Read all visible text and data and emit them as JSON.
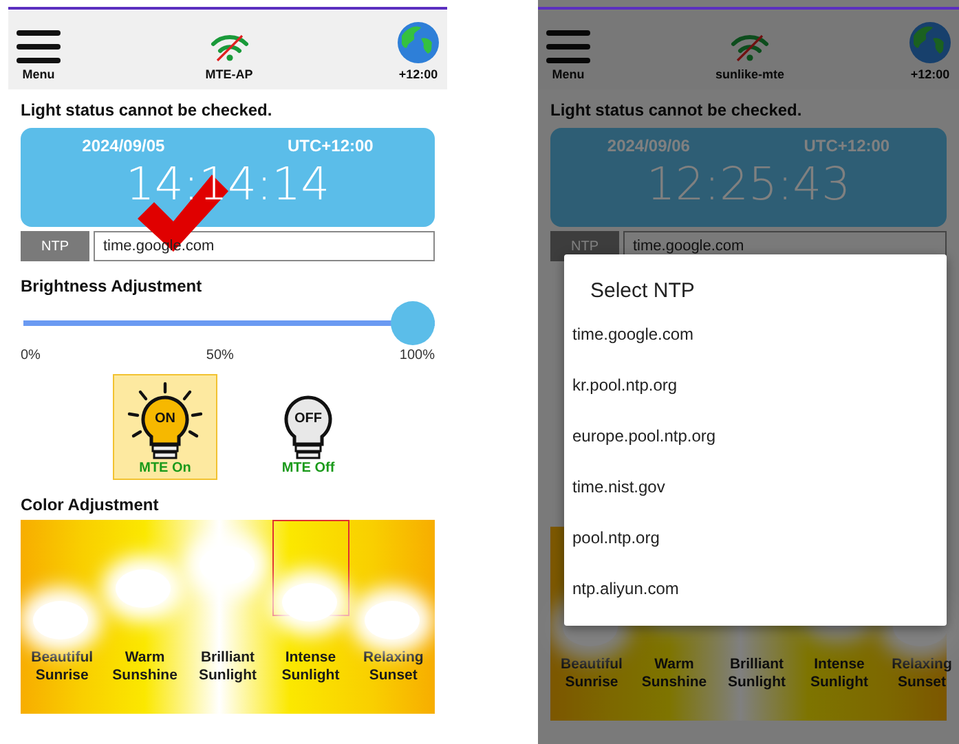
{
  "screens": [
    {
      "header": {
        "menu_label": "Menu",
        "network": "MTE-AP",
        "timezone": "+12:00"
      },
      "status": "Light status cannot be checked.",
      "clock": {
        "date": "2024/09/05",
        "utc": "UTC+12:00",
        "time": "14:14:14"
      },
      "ntp": {
        "label": "NTP",
        "value": "time.google.com"
      },
      "check_mark": true,
      "dimmed": false,
      "brightness": {
        "title": "Brightness Adjustment",
        "level": 1,
        "ticks": [
          "0%",
          "50%",
          "100%"
        ]
      },
      "modes": [
        {
          "kind": "on",
          "badge": "ON",
          "label": "MTE On",
          "selected": true
        },
        {
          "kind": "off",
          "badge": "OFF",
          "label": "MTE Off",
          "selected": false
        }
      ],
      "color": {
        "title": "Color Adjustment",
        "presets": [
          {
            "label": "Beautiful Sunrise",
            "selected": false
          },
          {
            "label": "Warm Sunshine",
            "selected": false
          },
          {
            "label": "Brilliant Sunlight",
            "selected": false
          },
          {
            "label": "Intense Sunlight",
            "selected": true
          },
          {
            "label": "Relaxing Sunset",
            "selected": false
          }
        ]
      }
    },
    {
      "header": {
        "menu_label": "Menu",
        "network": "sunlike-mte",
        "timezone": "+12:00"
      },
      "status": "Light status cannot be checked.",
      "clock": {
        "date": "2024/09/06",
        "utc": "UTC+12:00",
        "time": "12:25:43"
      },
      "ntp": {
        "label": "NTP",
        "value": "time.google.com"
      },
      "check_mark": false,
      "dimmed": true,
      "color": {
        "presets": [
          {
            "label": "Beautiful Sunrise",
            "selected": false
          },
          {
            "label": "Warm Sunshine",
            "selected": false
          },
          {
            "label": "Brilliant Sunlight",
            "selected": false
          },
          {
            "label": "Intense Sunlight",
            "selected": false
          },
          {
            "label": "Relaxing Sunset",
            "selected": false
          }
        ]
      },
      "dialog": {
        "title": "Select NTP",
        "options": [
          "time.google.com",
          "kr.pool.ntp.org",
          "europe.pool.ntp.org",
          "time.nist.gov",
          "pool.ntp.org",
          "ntp.aliyun.com"
        ]
      }
    }
  ]
}
